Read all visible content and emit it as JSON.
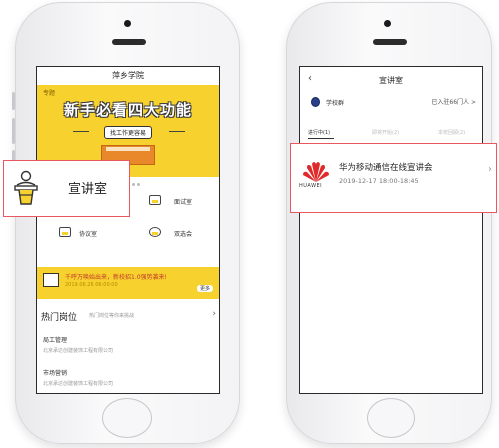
{
  "left_phone": {
    "title": "萍乡学院",
    "banner": {
      "tag": "专题",
      "headline": "新手必看四大功能",
      "subtitle": "找工作更容易"
    },
    "grid": [
      {
        "label": "面试室",
        "icon": "interview-room-icon"
      },
      {
        "label": "协议室",
        "icon": "agreement-room-icon"
      },
      {
        "label": "双选会",
        "icon": "job-fair-icon"
      }
    ],
    "notice": {
      "text": "千呼万唤始出来，新校招1.0强势袭来!",
      "date": "2019.06.26 06:00:00",
      "more": "更多"
    },
    "hot_jobs": {
      "title": "热门岗位",
      "subtitle": "热门岗位等你来挑战",
      "items": [
        {
          "title": "局工管理",
          "company": "北京承达创建装饰工程有限公司"
        },
        {
          "title": "市场营销",
          "company": "北京承达创建装饰工程有限公司"
        }
      ]
    },
    "callout": {
      "label": "宣讲室",
      "icon": "lecture-podium-icon"
    }
  },
  "right_phone": {
    "title": "宣讲室",
    "school": "学校群",
    "joined": "已入驻66门人 >",
    "tabs": [
      {
        "label": "进行中(1)",
        "active": true
      },
      {
        "label": "即将开始(2)",
        "active": false
      },
      {
        "label": "本校回顾(2)",
        "active": false
      }
    ],
    "event": {
      "logo_text": "HUAWEI",
      "title": "华为移动通信在线宣讲会",
      "time": "2019-12-17  18:00-18:45"
    }
  },
  "colors": {
    "accent_yellow": "#f7d22e",
    "callout_border": "#e8585e",
    "huawei_red": "#e02a2a"
  }
}
